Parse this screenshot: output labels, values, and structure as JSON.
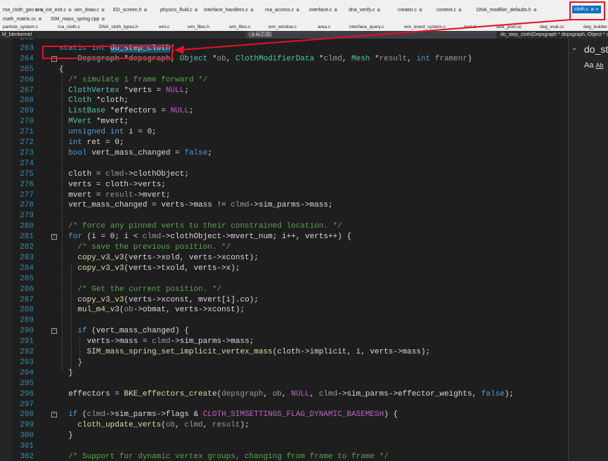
{
  "tabs_row1": [
    {
      "label": "rna_cloth_gen.c",
      "active": false
    },
    {
      "label": "wm_init_exit.c",
      "active": false
    },
    {
      "label": "wm_draw.c",
      "active": false
    },
    {
      "label": "ED_screen.h",
      "active": false
    },
    {
      "label": "physics_fluid.c",
      "active": false
    },
    {
      "label": "interface_handlers.c",
      "active": false
    },
    {
      "label": "rna_access.c",
      "active": false
    },
    {
      "label": "interface.c",
      "active": false
    },
    {
      "label": "dna_verify.c",
      "active": false
    },
    {
      "label": "creator.c",
      "active": false
    },
    {
      "label": "context.c",
      "active": false
    },
    {
      "label": "DNA_modifier_defaults.h",
      "active": false
    },
    {
      "label": "cloth.c",
      "active": true
    }
  ],
  "tabs_row2": [
    {
      "label": "math_matrix.cc"
    },
    {
      "label": "SIM_mass_spring.cpp"
    }
  ],
  "file_tabs": [
    "particle_system.c",
    "rna_cloth.c",
    "DNA_cloth_types.h",
    "wm.c",
    "wm_files.h",
    "wm_files.c",
    "wm_window.c",
    "area.c",
    "interface_query.c",
    "wm_event_system.c",
    "task.h",
    "task_pool.cc",
    "deg_eval.cc",
    "deg_builder"
  ],
  "navbar": {
    "project": "bf_blenkernel",
    "scope": "(全局范围)",
    "function": "do_step_cloth(Depsgraph * depsgraph, Object * ob, ClothModifierData * clmd, Mesh * result, int framenr)"
  },
  "find_panel": {
    "text": "do_ste",
    "aa": "Aa",
    "ab": "Ab"
  },
  "code_lines": [
    {
      "n": "262",
      "html": ""
    },
    {
      "n": "263",
      "html": "<span class='kw'>static</span> <span class='kw'>int</span> <span class='fn hl'>do_step_cloth</span>("
    },
    {
      "n": "264",
      "html": "    <span class='ty'>Depsgraph</span> *<span class='pa'>depsgraph</span>, <span class='ty'>Object</span> *<span class='pa'>ob</span>, <span class='ty'>ClothModifierData</span> *<span class='pa'>clmd</span>, <span class='ty'>Mesh</span> *<span class='pa'>result</span>, <span class='kw'>int</span> <span class='pa'>framenr</span>)"
    },
    {
      "n": "265",
      "html": "{"
    },
    {
      "n": "266",
      "html": "  <span class='cm'>/* simulate 1 frame forward */</span>"
    },
    {
      "n": "267",
      "html": "  <span class='ty'>ClothVertex</span> *verts = <span class='mc'>NULL</span>;"
    },
    {
      "n": "268",
      "html": "  <span class='ty'>Cloth</span> *cloth;"
    },
    {
      "n": "269",
      "html": "  <span class='ty'>ListBase</span> *effectors = <span class='mc'>NULL</span>;"
    },
    {
      "n": "270",
      "html": "  <span class='ty'>MVert</span> *mvert;"
    },
    {
      "n": "271",
      "html": "  <span class='kw'>unsigned</span> <span class='kw'>int</span> i = 0;"
    },
    {
      "n": "272",
      "html": "  <span class='kw'>int</span> ret = 0;"
    },
    {
      "n": "273",
      "html": "  <span class='kw'>bool</span> vert_mass_changed = <span class='kw'>false</span>;"
    },
    {
      "n": "274",
      "html": ""
    },
    {
      "n": "275",
      "html": "  cloth = <span class='pa'>clmd</span>-&gt;<span class='mb'>clothObject</span>;"
    },
    {
      "n": "276",
      "html": "  verts = cloth-&gt;<span class='mb'>verts</span>;"
    },
    {
      "n": "277",
      "html": "  mvert = <span class='pa'>result</span>-&gt;<span class='mb'>mvert</span>;"
    },
    {
      "n": "278",
      "html": "  vert_mass_changed = verts-&gt;<span class='mb'>mass</span> != <span class='pa'>clmd</span>-&gt;<span class='mb'>sim_parms</span>-&gt;<span class='mb'>mass</span>;"
    },
    {
      "n": "279",
      "html": ""
    },
    {
      "n": "280",
      "html": "  <span class='cm'>/* force any pinned verts to their constrained location. */</span>"
    },
    {
      "n": "281",
      "html": "  <span class='kw'>for</span> (i = 0; i &lt; <span class='pa'>clmd</span>-&gt;<span class='mb'>clothObject</span>-&gt;<span class='mb'>mvert_num</span>; i++, verts++) {"
    },
    {
      "n": "282",
      "html": "    <span class='cm'>/* save the previous position. */</span>"
    },
    {
      "n": "283",
      "html": "    <span class='fn'>copy_v3_v3</span>(verts-&gt;<span class='mb'>xold</span>, verts-&gt;<span class='mb'>xconst</span>);"
    },
    {
      "n": "284",
      "html": "    <span class='fn'>copy_v3_v3</span>(verts-&gt;<span class='mb'>txold</span>, verts-&gt;<span class='mb'>x</span>);"
    },
    {
      "n": "285",
      "html": ""
    },
    {
      "n": "286",
      "html": "    <span class='cm'>/* Get the current position. */</span>"
    },
    {
      "n": "287",
      "html": "    <span class='fn'>copy_v3_v3</span>(verts-&gt;<span class='mb'>xconst</span>, mvert[i].<span class='mb'>co</span>);"
    },
    {
      "n": "288",
      "html": "    <span class='fn'>mul_m4_v3</span>(<span class='pa'>ob</span>-&gt;<span class='mb'>obmat</span>, verts-&gt;<span class='mb'>xconst</span>);"
    },
    {
      "n": "289",
      "html": ""
    },
    {
      "n": "290",
      "html": "    <span class='kw'>if</span> (vert_mass_changed) {"
    },
    {
      "n": "291",
      "html": "      verts-&gt;<span class='mb'>mass</span> = <span class='pa'>clmd</span>-&gt;<span class='mb'>sim_parms</span>-&gt;<span class='mb'>mass</span>;"
    },
    {
      "n": "292",
      "html": "      <span class='fn'>SIM_mass_spring_set_implicit_vertex_mass</span>(cloth-&gt;<span class='mb'>implicit</span>, i, verts-&gt;<span class='mb'>mass</span>);"
    },
    {
      "n": "293",
      "html": "    }"
    },
    {
      "n": "294",
      "html": "  }"
    },
    {
      "n": "295",
      "html": ""
    },
    {
      "n": "296",
      "html": "  effectors = <span class='fn'>BKE_effectors_create</span>(<span class='pa'>depsgraph</span>, <span class='pa'>ob</span>, <span class='mc'>NULL</span>, <span class='pa'>clmd</span>-&gt;<span class='mb'>sim_parms</span>-&gt;<span class='mb'>effector_weights</span>, <span class='kw'>false</span>);"
    },
    {
      "n": "297",
      "html": ""
    },
    {
      "n": "298",
      "html": "  <span class='kw'>if</span> (<span class='pa'>clmd</span>-&gt;<span class='mb'>sim_parms</span>-&gt;<span class='mb'>flags</span> &amp; <span class='mc'>CLOTH_SIMSETTINGS_FLAG_DYNAMIC_BASEMESH</span>) {"
    },
    {
      "n": "299",
      "html": "    <span class='fn'>cloth_update_verts</span>(<span class='pa'>ob</span>, <span class='pa'>clmd</span>, <span class='pa'>result</span>);"
    },
    {
      "n": "300",
      "html": "  }"
    },
    {
      "n": "301",
      "html": ""
    },
    {
      "n": "302",
      "html": "  <span class='cm'>/* Support for dynamic vertex groups, changing from frame to frame */</span>"
    }
  ]
}
